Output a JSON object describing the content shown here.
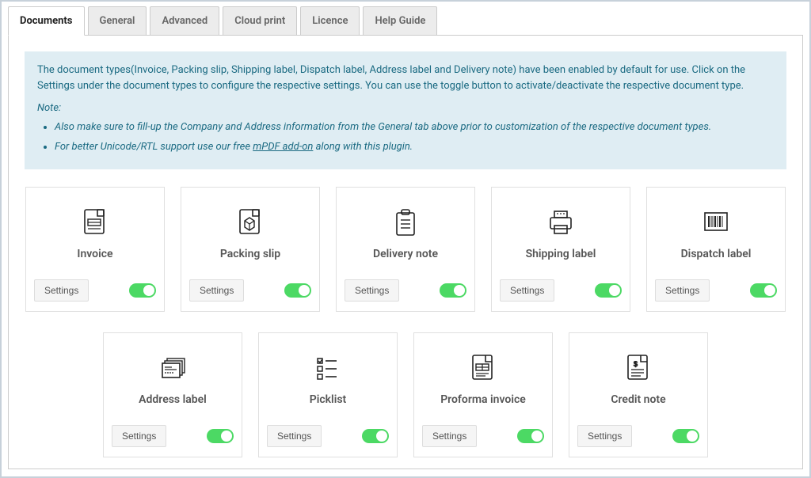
{
  "tabs": [
    {
      "label": "Documents",
      "active": true
    },
    {
      "label": "General",
      "active": false
    },
    {
      "label": "Advanced",
      "active": false
    },
    {
      "label": "Cloud print",
      "active": false
    },
    {
      "label": "Licence",
      "active": false
    },
    {
      "label": "Help Guide",
      "active": false
    }
  ],
  "info": {
    "intro": "The document types(Invoice, Packing slip, Shipping label, Dispatch label, Address label and Delivery note) have been enabled by default for use. Click on the Settings under the document types to configure the respective settings. You can use the toggle button to activate/deactivate the respective document type.",
    "note_label": "Note:",
    "bullet1": "Also make sure to fill-up the Company and Address information from the General tab above prior to customization of the respective document types.",
    "bullet2_prefix": "For better Unicode/RTL support use our free ",
    "bullet2_link": "mPDF add-on",
    "bullet2_suffix": " along with this plugin."
  },
  "settings_label": "Settings",
  "documents_row1": [
    {
      "title": "Invoice",
      "enabled": true,
      "icon": "invoice"
    },
    {
      "title": "Packing slip",
      "enabled": true,
      "icon": "packing-slip"
    },
    {
      "title": "Delivery note",
      "enabled": true,
      "icon": "delivery-note"
    },
    {
      "title": "Shipping label",
      "enabled": true,
      "icon": "shipping-label"
    },
    {
      "title": "Dispatch label",
      "enabled": true,
      "icon": "dispatch-label"
    }
  ],
  "documents_row2": [
    {
      "title": "Address label",
      "enabled": true,
      "icon": "address-label"
    },
    {
      "title": "Picklist",
      "enabled": true,
      "icon": "picklist"
    },
    {
      "title": "Proforma invoice",
      "enabled": true,
      "icon": "proforma-invoice"
    },
    {
      "title": "Credit note",
      "enabled": true,
      "icon": "credit-note"
    }
  ]
}
